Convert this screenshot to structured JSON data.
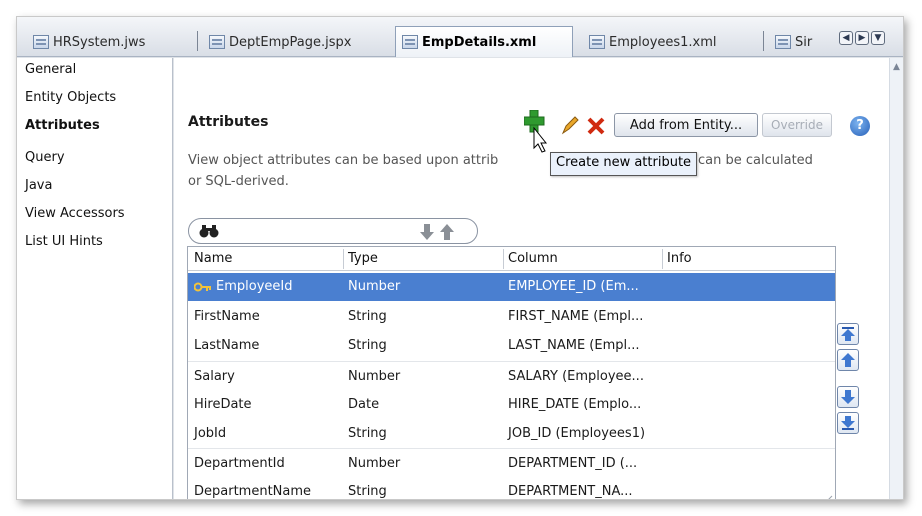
{
  "tabs": [
    {
      "label": "HRSystem.jws",
      "active": false
    },
    {
      "label": "DeptEmpPage.jspx",
      "active": false
    },
    {
      "label": "EmpDetails.xml",
      "active": true
    },
    {
      "label": "Employees1.xml",
      "active": false
    },
    {
      "label": "Sir",
      "active": false
    }
  ],
  "nav": {
    "items": [
      {
        "label": "General"
      },
      {
        "label": "Entity Objects"
      },
      {
        "label": "Attributes",
        "active": true
      },
      {
        "label": "Query"
      },
      {
        "label": "Java"
      },
      {
        "label": "View Accessors"
      },
      {
        "label": "List UI Hints"
      }
    ]
  },
  "main": {
    "title": "Attributes",
    "description_line1": "View object attributes can be based upon attrib",
    "description_line1_end": "ect or can be calculated",
    "description_line2": "or SQL-derived.",
    "tooltip": "Create new attribute",
    "add_from_entity": "Add from Entity...",
    "override": "Override",
    "help": "?"
  },
  "table": {
    "columns": [
      "Name",
      "Type",
      "Column",
      "Info"
    ],
    "rows": [
      {
        "name": "EmployeeId",
        "type": "Number",
        "column": "EMPLOYEE_ID (Em...",
        "info": "",
        "key": true
      },
      {
        "name": "FirstName",
        "type": "String",
        "column": "FIRST_NAME (Empl...",
        "info": ""
      },
      {
        "name": "LastName",
        "type": "String",
        "column": "LAST_NAME (Empl...",
        "info": ""
      },
      {
        "name": "Salary",
        "type": "Number",
        "column": "SALARY (Employee...",
        "info": ""
      },
      {
        "name": "HireDate",
        "type": "Date",
        "column": "HIRE_DATE (Emplo...",
        "info": ""
      },
      {
        "name": "JobId",
        "type": "String",
        "column": "JOB_ID (Employees1)",
        "info": ""
      },
      {
        "name": "DepartmentId",
        "type": "Number",
        "column": "DEPARTMENT_ID (...",
        "info": ""
      },
      {
        "name": "DepartmentName",
        "type": "String",
        "column": "DEPARTMENT_NA...",
        "info": ""
      }
    ]
  },
  "colors": {
    "selection": "#4a7fd0",
    "add_icon": "#2f9a2f",
    "delete_icon": "#d02a10"
  }
}
